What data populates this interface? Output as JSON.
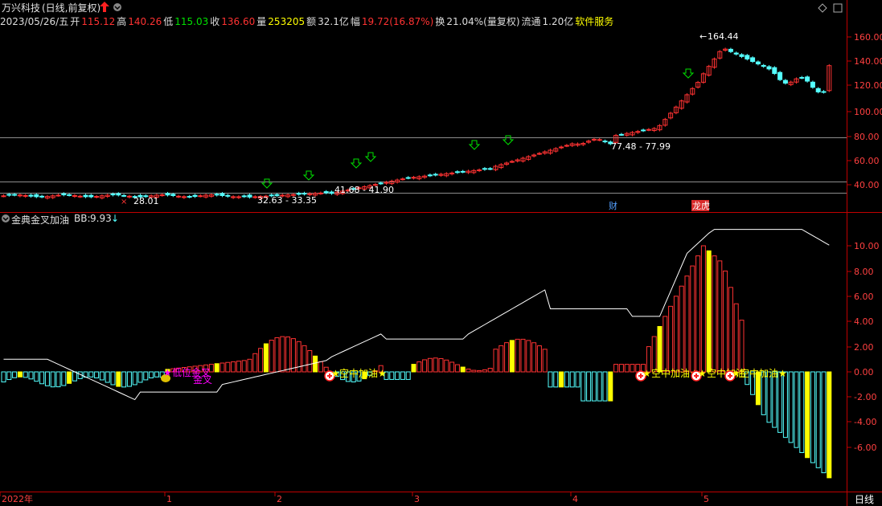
{
  "stock": {
    "title": "万兴科技",
    "mode": "(日线,前复权)"
  },
  "info": {
    "date": "2023/05/26/五",
    "open_label": "开",
    "open": "115.12",
    "high_label": "高",
    "high": "140.26",
    "low_label": "低",
    "low": "115.03",
    "close_label": "收",
    "close": "136.60",
    "vol_label": "量",
    "vol": "253205",
    "amt_label": "额",
    "amt": "32.1亿",
    "chg_label": "幅",
    "chg": "19.72(16.87%)",
    "turn_label": "换",
    "turn": "21.04%(量复权)",
    "float_label": "流通",
    "float": "1.20亿",
    "sector": "软件服务"
  },
  "main_chart": {
    "y_ticks": [
      "160.00",
      "140.00",
      "120.00",
      "100.00",
      "80.00",
      "60.00",
      "40.00"
    ],
    "annotations": {
      "high_price": "164.44",
      "low_price": "28.01",
      "range1": "32.63 - 33.35",
      "range2": "41.68 - 41.90",
      "range3": "77.48 - 77.99",
      "tag_cai": "财",
      "tag_longhu": "龙虎"
    }
  },
  "indicator": {
    "name": "金典金叉加油",
    "bb_label": "BB:",
    "bb_value": "9.93",
    "y_ticks": [
      "10.00",
      "8.00",
      "6.00",
      "4.00",
      "2.00",
      "0.00",
      "-2.00",
      "-4.00",
      "-6.00"
    ],
    "signals": {
      "low_cross": "低位金叉",
      "low_cross_sub": "金叉",
      "air_refuel": "空中加油"
    }
  },
  "time_axis": {
    "labels": [
      "2022年",
      "1",
      "2",
      "3",
      "4",
      "5"
    ],
    "period": "日线"
  },
  "colors": {
    "up": "#ff3232",
    "down": "#54ffff",
    "axis": "#c00000",
    "signal_text": "#ffff00",
    "magenta": "#ff00ff"
  }
}
